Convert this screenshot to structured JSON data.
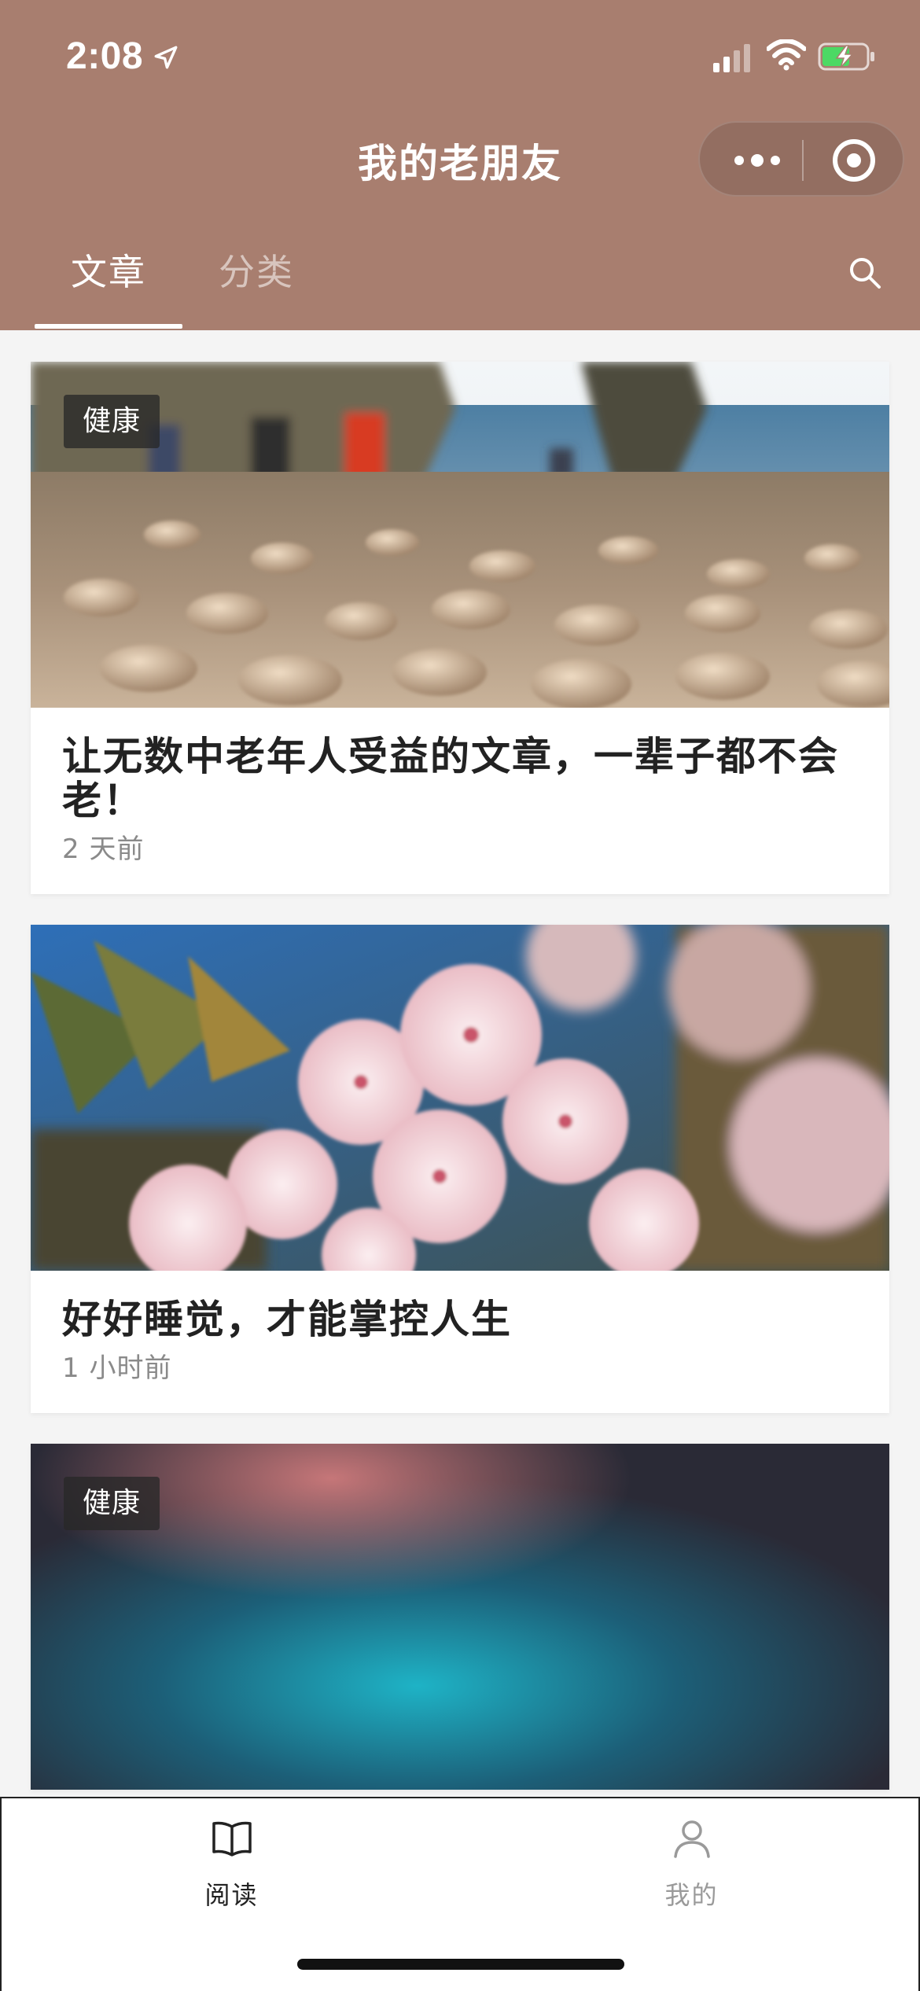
{
  "status_bar": {
    "time": "2:08"
  },
  "nav": {
    "title": "我的老朋友"
  },
  "tabs": [
    {
      "label": "文章",
      "active": true
    },
    {
      "label": "分类",
      "active": false
    }
  ],
  "articles": [
    {
      "tag": "健康",
      "title": "让无数中老年人受益的文章，一辈子都不会老！",
      "time": "2 天前",
      "image": "pebble-beach-photo"
    },
    {
      "tag": "",
      "title": "好好睡觉，才能掌控人生",
      "time": "1 小时前",
      "image": "pink-blossom-photo"
    },
    {
      "tag": "健康",
      "title": "",
      "time": "",
      "image": "blurred-teal-photo"
    }
  ],
  "tabbar": {
    "items": [
      {
        "label": "阅读",
        "icon": "book-icon",
        "active": true
      },
      {
        "label": "我的",
        "icon": "person-icon",
        "active": false
      }
    ]
  },
  "colors": {
    "header_bg": "#a87e6f",
    "page_bg": "#f4f4f4",
    "battery_green": "#4cd964"
  }
}
